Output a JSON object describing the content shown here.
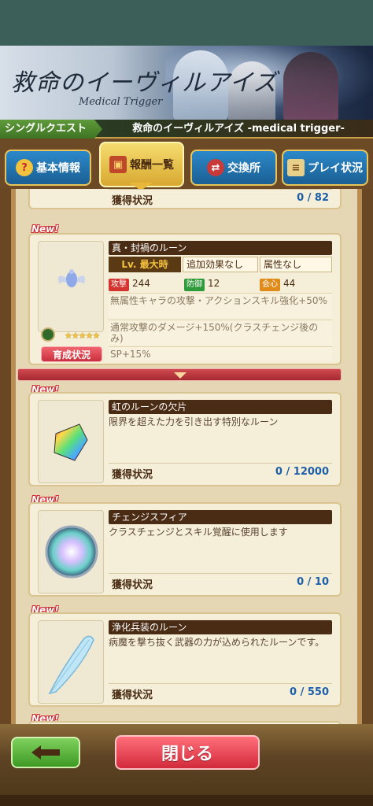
{
  "banner": {
    "logo_main": "救命のイーヴィルアイズ",
    "logo_sub": "Medical Trigger"
  },
  "quest": {
    "type": "シングルクエスト",
    "name": "救命のイーヴィルアイズ -medical trigger-"
  },
  "tabs": [
    {
      "label": "基本情報",
      "icon": "question-icon",
      "active": false
    },
    {
      "label": "報酬一覧",
      "icon": "treasure-chest-icon",
      "active": true
    },
    {
      "label": "交換所",
      "icon": "exchange-bag-icon",
      "active": false
    },
    {
      "label": "プレイ状況",
      "icon": "scroll-icon",
      "active": false
    }
  ],
  "partial_card": {
    "status_label": "獲得状況",
    "status_value": "0 / 82"
  },
  "new_label": "New!",
  "rune": {
    "name": "真・封禍のルーン",
    "level": "Lv. 最大時",
    "extra_effect": "追加効果なし",
    "attribute": "属性なし",
    "stats": [
      {
        "tag": "攻撃",
        "value": "244",
        "color": "#d4342f"
      },
      {
        "tag": "防御",
        "value": "12",
        "color": "#2f9a3a"
      },
      {
        "tag": "会心",
        "value": "44",
        "color": "#e08a1a"
      }
    ],
    "desc1": "無属性キャラの攻撃・アクションスキル強化+50%",
    "desc2": "通常攻撃のダメージ+150%(クラスチェンジ後のみ)",
    "desc3": "SP+15%",
    "rarity": "★★★★★",
    "train_button": "育成状況"
  },
  "items": [
    {
      "name": "虹のルーンの欠片",
      "desc": "限界を超えた力を引き出す特別なルーン",
      "status_label": "獲得状況",
      "status_value": "0 / 12000",
      "icon": "rainbow-shard-icon"
    },
    {
      "name": "チェンジスフィア",
      "desc": "クラスチェンジとスキル覚醒に使用します",
      "status_label": "獲得状況",
      "status_value": "0 / 10",
      "icon": "sphere-icon"
    },
    {
      "name": "浄化兵装のルーン",
      "desc": "病魔を撃ち抜く武器の力が込められたルーンです。",
      "status_label": "獲得状況",
      "status_value": "0 / 550",
      "icon": "feather-rune-icon"
    }
  ],
  "footer": {
    "back_icon": "arrow-left-icon",
    "close_label": "閉じる"
  }
}
